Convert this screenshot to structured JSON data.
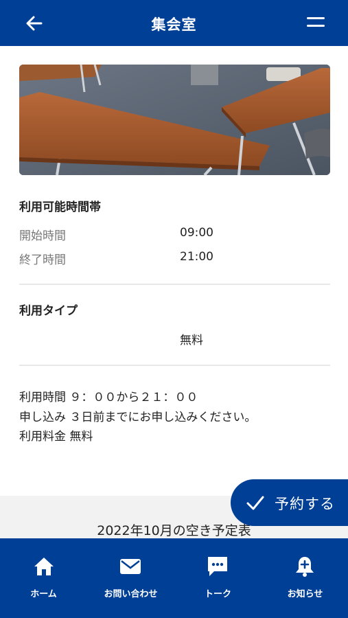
{
  "header": {
    "title": "集会室",
    "back_icon": "arrow-left-icon",
    "menu_icon": "menu-icon"
  },
  "hero": {
    "image": "meeting-room-photo"
  },
  "availability": {
    "heading": "利用可能時間帯",
    "rows": [
      {
        "label": "開始時間",
        "value": "09:00"
      },
      {
        "label": "終了時間",
        "value": "21:00"
      }
    ]
  },
  "usage_type": {
    "heading": "利用タイプ",
    "value": "無料"
  },
  "notes": [
    "利用時間 ９：００から２１：００",
    "申し込み ３日前までにお申し込みください。",
    "利用料金 無料"
  ],
  "schedule": {
    "title": "2022年10月の空き予定表"
  },
  "reserve_button": {
    "label": "予約する",
    "icon": "check-icon"
  },
  "bottom_nav": [
    {
      "label": "ホーム",
      "icon": "home-icon"
    },
    {
      "label": "お問い合わせ",
      "icon": "mail-icon"
    },
    {
      "label": "トーク",
      "icon": "chat-icon"
    },
    {
      "label": "お知らせ",
      "icon": "bell-icon"
    }
  ],
  "colors": {
    "primary": "#003f96",
    "divider": "#e8e8e8",
    "muted_text": "#777777"
  }
}
